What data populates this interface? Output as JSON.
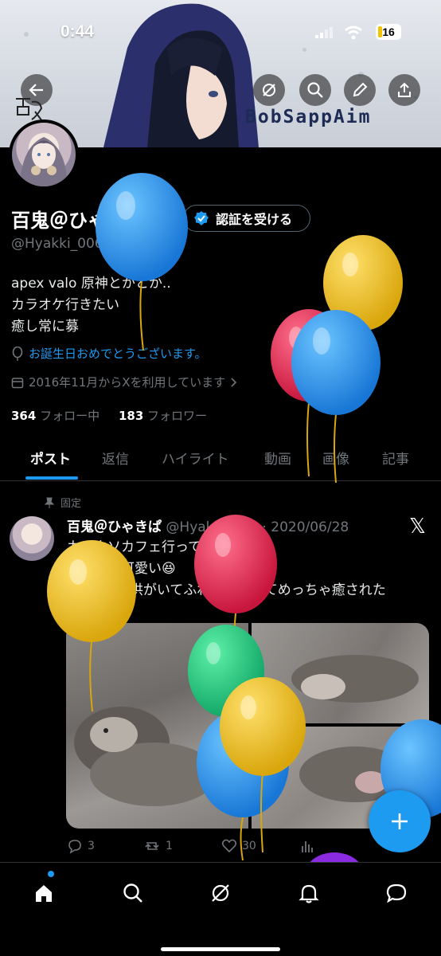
{
  "status_bar": {
    "time": "0:44",
    "battery": "16"
  },
  "banner": {
    "watermark": "BobSappAim",
    "signature": "百鬼"
  },
  "profile": {
    "name": "百鬼＠ひゃきぱ",
    "verify_label": "認証を受ける",
    "handle": "@Hyakki_006",
    "bio": "apex valo 原神とかとか..\nカラオケ行きたい\n癒し常に募",
    "birthday": "お誕生日おめでとうございます。",
    "joined": "2016年11月からXを利用しています",
    "following_count": "364",
    "following_label": "フォロー中",
    "followers_count": "183",
    "followers_label": "フォロワー"
  },
  "tabs": [
    {
      "label": "ポスト",
      "active": true
    },
    {
      "label": "返信"
    },
    {
      "label": "ハイライト"
    },
    {
      "label": "動画"
    },
    {
      "label": "画像"
    },
    {
      "label": "記事"
    }
  ],
  "post": {
    "pinned_label": "固定",
    "author": "百鬼＠ひゃきぱ",
    "handle": "@Hyakki_006",
    "date": "2020/06/28",
    "text": "カワウソカフェ行ってきた！\nめっちゃ可愛い😆\n2ヶ月の子供がいてふわふわしててめっちゃ癒された\n☺️",
    "replies": "3",
    "reposts": "1",
    "likes": "30"
  },
  "colors": {
    "accent": "#1d9bf0",
    "background": "#000000",
    "muted": "#71767b"
  },
  "icons": [
    "back-arrow-icon",
    "grok-icon",
    "search-icon",
    "edit-icon",
    "share-icon",
    "verified-badge-icon",
    "balloon-icon",
    "calendar-icon",
    "pin-icon",
    "x-logo-icon",
    "reply-icon",
    "repost-icon",
    "like-icon",
    "views-icon",
    "compose-plus-icon",
    "home-icon",
    "search-icon",
    "grok-icon",
    "bell-icon",
    "messages-icon"
  ]
}
